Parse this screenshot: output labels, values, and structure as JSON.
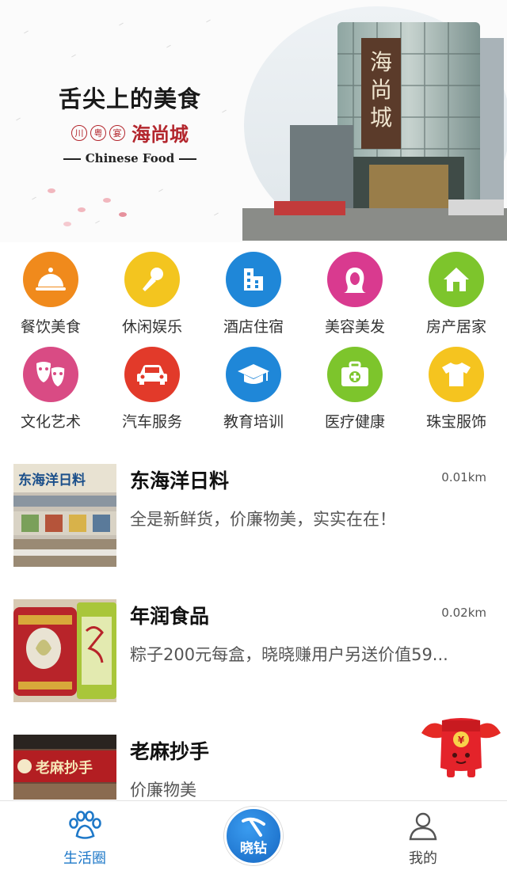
{
  "banner": {
    "title": "舌尖上的美食",
    "seals": [
      "川",
      "粤",
      "宴"
    ],
    "store_name": "海尚城",
    "english": "Chinese Food",
    "sign_text": "海尚城"
  },
  "categories": [
    {
      "label": "餐饮美食",
      "icon": "cloche-icon",
      "color": "#f08a1c"
    },
    {
      "label": "休闲娱乐",
      "icon": "microphone-icon",
      "color": "#f3c51f"
    },
    {
      "label": "酒店住宿",
      "icon": "hotel-icon",
      "color": "#1f87d8"
    },
    {
      "label": "美容美发",
      "icon": "woman-hair-icon",
      "color": "#d93a8f"
    },
    {
      "label": "房产居家",
      "icon": "house-icon",
      "color": "#7dc52c"
    },
    {
      "label": "文化艺术",
      "icon": "theater-masks-icon",
      "color": "#d94b84"
    },
    {
      "label": "汽车服务",
      "icon": "car-icon",
      "color": "#e23a2a"
    },
    {
      "label": "教育培训",
      "icon": "graduation-cap-icon",
      "color": "#1f87d8"
    },
    {
      "label": "医疗健康",
      "icon": "medical-kit-icon",
      "color": "#7dc52c"
    },
    {
      "label": "珠宝服饰",
      "icon": "shirt-icon",
      "color": "#f5c41f"
    }
  ],
  "listings": [
    {
      "title": "东海洋日料",
      "distance": "0.01km",
      "desc": "全是新鲜货，价廉物美，实实在在！",
      "thumb_sign": "东海洋日料"
    },
    {
      "title": "年润食品",
      "distance": "0.02km",
      "desc": "粽子200元每盒，晓晓赚用户另送价值59...",
      "thumb_sign": ""
    },
    {
      "title": "老麻抄手",
      "distance": "",
      "desc": "价廉物美",
      "thumb_sign": "老麻抄手"
    }
  ],
  "tabbar": {
    "left_label": "生活圈",
    "center_label": "晓钻",
    "right_label": "我的"
  },
  "colors": {
    "accent": "#1e78c8",
    "seal_red": "#b3262d"
  }
}
